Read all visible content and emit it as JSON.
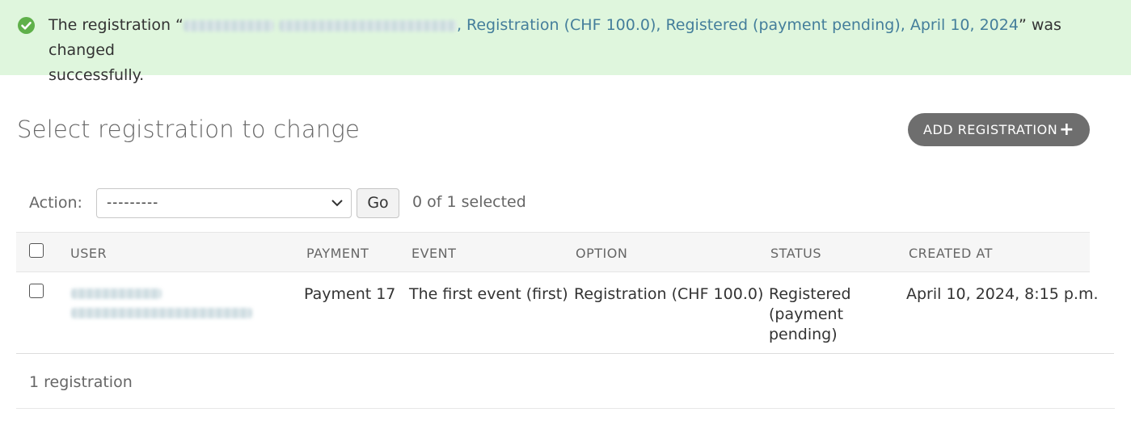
{
  "message": {
    "prefix": "The registration “",
    "linked_text": ", Registration (CHF 100.0), Registered (payment pending), April 10, 2024",
    "suffix": "” was changed",
    "line2": "successfully.",
    "icon": "check-circle-icon"
  },
  "page": {
    "title": "Select registration to change",
    "add_button": "ADD REGISTRATION",
    "add_icon": "plus-icon"
  },
  "actions": {
    "label": "Action:",
    "selected_value": "---------",
    "go_label": "Go",
    "selection_count": "0 of 1 selected"
  },
  "table": {
    "columns": [
      "USER",
      "PAYMENT",
      "EVENT",
      "OPTION",
      "STATUS",
      "CREATED AT"
    ],
    "rows": [
      {
        "payment": "Payment 17",
        "event": "The first event (first)",
        "option": "Registration (CHF 100.0)",
        "status": "Registered (payment pending)",
        "created_at": "April 10, 2024, 8:15 p.m."
      }
    ]
  },
  "footer": {
    "count": "1 registration"
  },
  "colors": {
    "success_bg": "#dff6dd",
    "link": "#447e9b",
    "button_bg": "#6e6e6e"
  }
}
